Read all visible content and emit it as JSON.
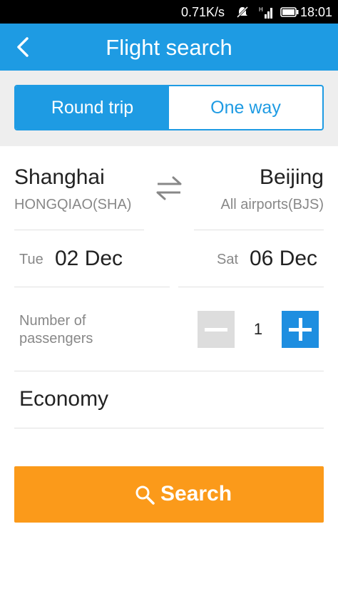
{
  "status_bar": {
    "speed": "0.71K/s",
    "time": "18:01",
    "icons": [
      "mute-icon",
      "signal-icon",
      "battery-icon"
    ]
  },
  "header": {
    "title": "Flight search",
    "back_icon": "chevron-left-icon"
  },
  "trip_type": {
    "options": [
      "Round trip",
      "One way"
    ],
    "selected": "Round trip"
  },
  "origin": {
    "city": "Shanghai",
    "airport": "HONGQIAO(SHA)"
  },
  "destination": {
    "city": "Beijing",
    "airport": "All airports(BJS)"
  },
  "swap_icon": "swap-arrows-icon",
  "depart": {
    "day": "Tue",
    "date": "02 Dec"
  },
  "return": {
    "day": "Sat",
    "date": "06 Dec"
  },
  "passengers": {
    "label": "Number of passengers",
    "count": "1"
  },
  "cabin": {
    "class": "Economy"
  },
  "search_button": {
    "label": "Search",
    "icon": "search-icon"
  },
  "colors": {
    "primary": "#1e9be3",
    "accent": "#fb9a1a",
    "stepper_disabled": "#dddddd"
  }
}
